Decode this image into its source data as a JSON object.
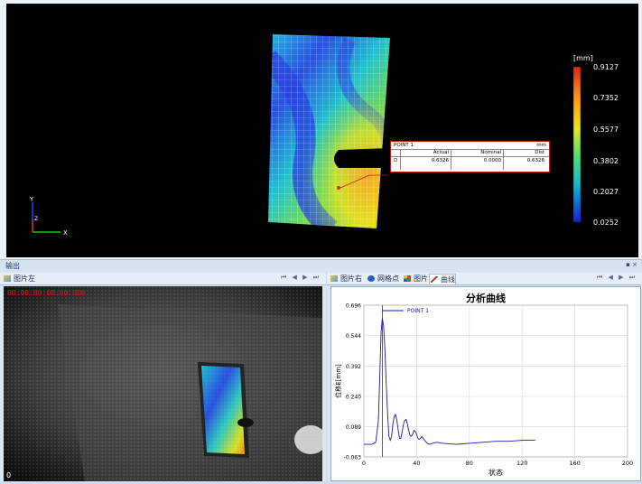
{
  "viewport": {
    "legend": {
      "unit": "[mm]",
      "ticks": [
        "0.9127",
        "0.7352",
        "0.5577",
        "0.3802",
        "0.2027",
        "0.0252"
      ]
    },
    "axes": {
      "y": "Y",
      "z": "Z",
      "x": "X"
    },
    "probe": {
      "name": "POINT 1",
      "unit": "mm",
      "headers": [
        "Actual",
        "Nominal",
        "Dist"
      ],
      "row_label": "D",
      "actual": "0.6326",
      "nominal": "0.0000",
      "dist": "0.6326"
    }
  },
  "split": {
    "title": "输出",
    "pin": "▪ ×"
  },
  "left_panel": {
    "tab_label": "图片左",
    "nav": "⏮ ◀ ▶ ⏭",
    "timestamp": "00:00:00:00:00:000",
    "frame": "0"
  },
  "right_panel": {
    "tabs": [
      "图片右",
      "网格点",
      "图片",
      "曲线"
    ],
    "nav": "⏮ ◀ ▶ ⏭"
  },
  "chart_data": {
    "type": "line",
    "title": "分析曲线",
    "xlabel": "状态",
    "ylabel": "位移E[mm]",
    "xlim": [
      0,
      200
    ],
    "ylim": [
      -0.063,
      0.696
    ],
    "xticks": [
      0,
      40,
      80,
      120,
      160,
      200
    ],
    "yticks": [
      -0.063,
      0.089,
      0.24,
      0.392,
      0.544,
      0.696
    ],
    "ytick_labels": [
      "-0.063",
      "0.089",
      "0.240",
      "0.392",
      "0.544",
      "0.696"
    ],
    "grid": true,
    "legend": "top-left",
    "series": [
      {
        "name": "POINT 1",
        "color": "#1a1aa8",
        "x": [
          0,
          6,
          9,
          11,
          12,
          13,
          14,
          15,
          16,
          17,
          18,
          19,
          20,
          21,
          22,
          23,
          24,
          25,
          26,
          27,
          28,
          29,
          30,
          31,
          32,
          33,
          34,
          35,
          36,
          37,
          38,
          39,
          40,
          41,
          42,
          43,
          44,
          46,
          48,
          50,
          52,
          55,
          60,
          70,
          80,
          90,
          100,
          110,
          120,
          130
        ],
        "y": [
          0.0,
          0.0,
          0.01,
          0.12,
          0.33,
          0.56,
          0.63,
          0.59,
          0.46,
          0.3,
          0.15,
          0.04,
          0.02,
          0.04,
          0.1,
          0.14,
          0.15,
          0.12,
          0.07,
          0.03,
          0.03,
          0.06,
          0.1,
          0.12,
          0.125,
          0.1,
          0.07,
          0.045,
          0.04,
          0.05,
          0.07,
          0.065,
          0.05,
          0.03,
          0.025,
          0.03,
          0.04,
          0.02,
          0.005,
          0.0,
          0.005,
          0.01,
          0.005,
          0.0,
          0.005,
          0.01,
          0.015,
          0.015,
          0.02,
          0.02
        ]
      }
    ],
    "marker_x": 14
  },
  "colors": {
    "viewport_bg": "#000000",
    "probe_line": "#c01818",
    "series": "#1a1aa8",
    "marker": "#c01818",
    "timestamp": "#e01010"
  }
}
